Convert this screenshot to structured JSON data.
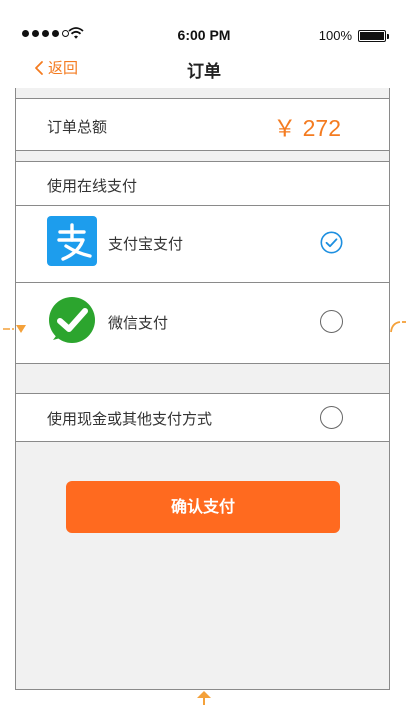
{
  "status_bar": {
    "time": "6:00 PM",
    "battery_percent": "100%"
  },
  "nav": {
    "back_label": "返回",
    "title": "订单"
  },
  "order": {
    "total_label": "订单总额",
    "total_value": "￥ 272"
  },
  "online_payment": {
    "header": "使用在线支付",
    "options": [
      {
        "label": "支付宝支付",
        "icon": "alipay-icon",
        "selected": true
      },
      {
        "label": "微信支付",
        "icon": "wechat-icon",
        "selected": false
      }
    ]
  },
  "other_payment": {
    "label": "使用现金或其他支付方式",
    "selected": false
  },
  "confirm_button": {
    "label": "确认支付"
  },
  "colors": {
    "accent": "#f47b20",
    "button": "#ff6a1f",
    "alipay_blue": "#1d9ded",
    "wechat_green": "#2ca52e",
    "panel_bg": "#f1f1f1"
  }
}
